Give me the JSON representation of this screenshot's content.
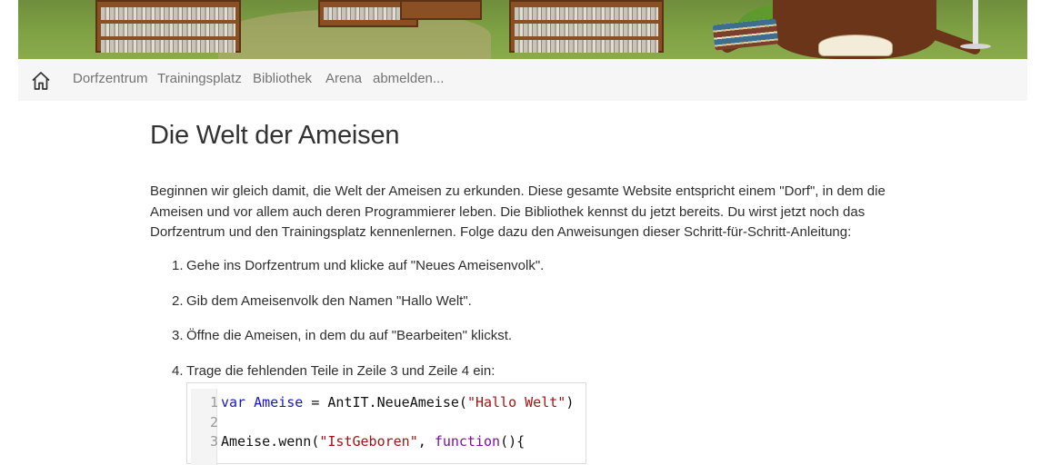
{
  "nav": {
    "home_icon": "home-icon",
    "items": [
      {
        "label": "Dorfzentrum"
      },
      {
        "label": "Trainingsplatz"
      },
      {
        "label": "Bibliothek"
      },
      {
        "label": "Arena"
      },
      {
        "label": "abmelden..."
      }
    ]
  },
  "page": {
    "title": "Die Welt der Ameisen",
    "intro": "Beginnen wir gleich damit, die Welt der Ameisen zu erkunden. Diese gesamte Website entspricht einem \"Dorf\", in dem die Ameisen und vor allem auch deren Programmierer leben. Die Bibliothek kennst du jetzt bereits. Du wirst jetzt noch das Dorfzentrum und den Trainingsplatz kennenlernen. Folge dazu den Anweisungen dieser Schritt-für-Schritt-Anleitung:",
    "steps": [
      {
        "num": "1.",
        "text": "Gehe ins Dorfzentrum und klicke auf \"Neues Ameisenvolk\"."
      },
      {
        "num": "2.",
        "text": "Gib dem Ameisenvolk den Namen \"Hallo Welt\"."
      },
      {
        "num": "3.",
        "text": "Öffne die Ameisen, in dem du auf \"Bearbeiten\" klickst."
      },
      {
        "num": "4.",
        "text": "Trage die fehlenden Teile in Zeile 3 und Zeile 4 ein:"
      }
    ]
  },
  "code": {
    "line_numbers": [
      "1",
      "2",
      "3"
    ],
    "line1": {
      "kw": "var",
      "var": "Ameise",
      "mid": " = AntIT.NeueAmeise(",
      "str": "\"Hallo Welt\"",
      "end": ")"
    },
    "line3": {
      "start": "Ameise.wenn(",
      "str": "\"IstGeboren\"",
      "sep": ", ",
      "kw": "function",
      "end": "(){"
    }
  }
}
